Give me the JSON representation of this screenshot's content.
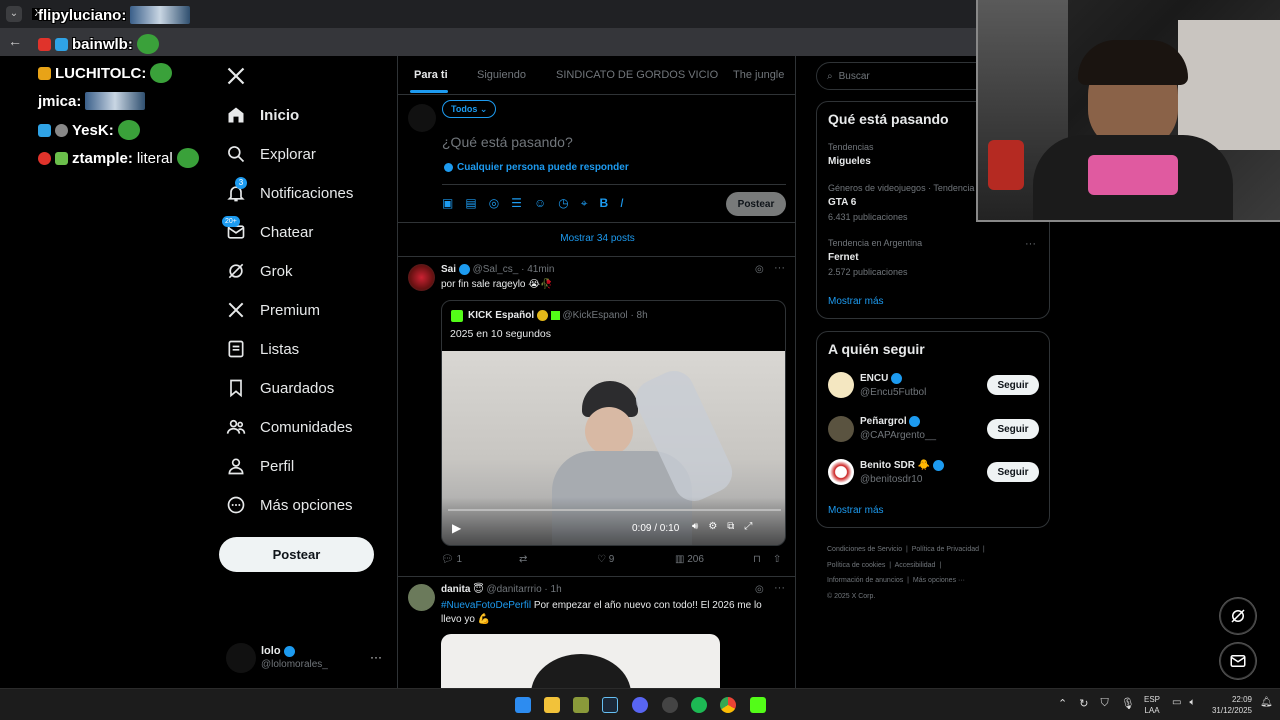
{
  "browser": {
    "tab_chevron": "⌄",
    "tab_icon": "X"
  },
  "chat": [
    {
      "user": "flipyluciano:",
      "color": "#ffffff"
    },
    {
      "user": "bainwlb:",
      "color": "#ffffff"
    },
    {
      "user": "LUCHITOLC:",
      "color": "#ffffff"
    },
    {
      "user": "jmica:",
      "color": "#ffffff"
    },
    {
      "user": "YesK:",
      "color": "#ffffff"
    },
    {
      "user": "ztample:",
      "message": "literal",
      "color": "#ffffff"
    }
  ],
  "nav": {
    "items": [
      {
        "label": "Inicio",
        "icon": "home-icon"
      },
      {
        "label": "Explorar",
        "icon": "search-icon"
      },
      {
        "label": "Notificaciones",
        "icon": "bell-icon",
        "badge": "3"
      },
      {
        "label": "Chatear",
        "icon": "mail-icon",
        "badge": "20+"
      },
      {
        "label": "Grok",
        "icon": "grok-icon"
      },
      {
        "label": "Premium",
        "icon": "x-icon"
      },
      {
        "label": "Listas",
        "icon": "list-icon"
      },
      {
        "label": "Guardados",
        "icon": "bookmark-icon"
      },
      {
        "label": "Comunidades",
        "icon": "people-icon"
      },
      {
        "label": "Perfil",
        "icon": "person-icon"
      },
      {
        "label": "Más opciones",
        "icon": "more-circle-icon"
      }
    ],
    "post_label": "Postear",
    "account": {
      "name": "lolo",
      "handle": "@lolomorales_",
      "more": "···"
    }
  },
  "feed": {
    "tabs": [
      "Para ti",
      "Siguiendo",
      "SINDICATO DE GORDOS VICIO",
      "The jungle"
    ],
    "composer": {
      "audience": "Todos",
      "placeholder": "¿Qué está pasando?",
      "reply_setting": "Cualquier persona puede responder",
      "post_label": "Postear"
    },
    "show_more": "Mostrar 34 posts",
    "posts": [
      {
        "name": "Sai",
        "handle": "@Sal_cs_",
        "time": "· 41min",
        "text": "por fin sale rageylo 😭🥀",
        "quote": {
          "name": "KICK Español",
          "handle": "@KickEspanol",
          "time": "· 8h",
          "text": "2025 en 10 segundos",
          "video_time": "0:09 / 0:10"
        },
        "replies": "1",
        "retweets": "",
        "likes": "9",
        "views": "206"
      },
      {
        "name": "danita",
        "handle": "@danitarrrio",
        "time": "· 1h",
        "hashtag": "#NuevaFotoDePerfil",
        "text": " Por empezar el año nuevo con todo!! El 2026 me lo llevo yo 💪"
      }
    ]
  },
  "sidebar": {
    "search_placeholder": "Buscar",
    "trends_title": "Qué está pasando",
    "trends": [
      {
        "meta": "Tendencias",
        "name": "Migueles",
        "count": ""
      },
      {
        "meta": "Géneros de videojuegos · Tendencia",
        "name": "GTA 6",
        "count": "6.431 publicaciones"
      },
      {
        "meta": "Tendencia en Argentina",
        "name": "Fernet",
        "count": "2.572 publicaciones"
      }
    ],
    "trends_more": "Mostrar más",
    "follow_title": "A quién seguir",
    "follow": [
      {
        "name": "ENCU",
        "handle": "@Encu5Futbol",
        "button": "Seguir"
      },
      {
        "name": "Peñargrol",
        "handle": "@CAPArgento__",
        "button": "Seguir"
      },
      {
        "name": "Benito SDR 🐥",
        "handle": "@benitosdr10",
        "button": "Seguir"
      }
    ],
    "follow_more": "Mostrar más",
    "footer": [
      "Condiciones de Servicio",
      "Política de Privacidad",
      "Política de cookies",
      "Accesibilidad",
      "Información de anuncios",
      "Más opciones ···",
      "© 2025 X Corp."
    ]
  },
  "taskbar": {
    "lang": "ESP",
    "layout": "LAA",
    "time": "22:09",
    "date": "31/12/2025"
  }
}
